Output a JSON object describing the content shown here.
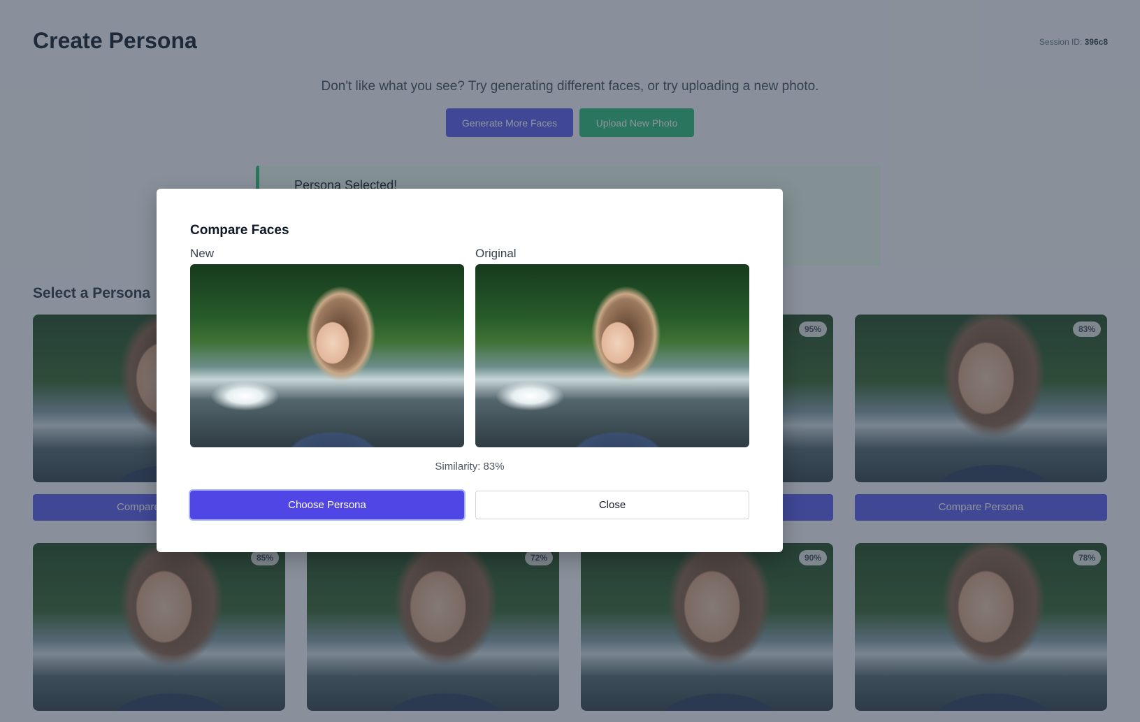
{
  "page": {
    "title": "Create Persona",
    "session_label": "Session ID:",
    "session_id": "396c8",
    "prompt": "Don't like what you see? Try generating different faces, or try uploading a new photo.",
    "generate_label": "Generate More Faces",
    "upload_label": "Upload New Photo",
    "alert_title": "Persona Selected!",
    "section_title": "Select a Persona",
    "compare_label": "Compare Persona",
    "compare_label_partial": "Compare"
  },
  "cards": [
    {
      "badge": ""
    },
    {
      "badge": ""
    },
    {
      "badge": "95%"
    },
    {
      "badge": "83%"
    },
    {
      "badge": "85%"
    },
    {
      "badge": "72%"
    },
    {
      "badge": "90%"
    },
    {
      "badge": "78%"
    }
  ],
  "modal": {
    "title": "Compare Faces",
    "new_label": "New",
    "original_label": "Original",
    "similarity": "Similarity: 83%",
    "choose_label": "Choose Persona",
    "close_label": "Close"
  },
  "colors": {
    "primary": "#4f46e5",
    "success": "#34c07e"
  }
}
